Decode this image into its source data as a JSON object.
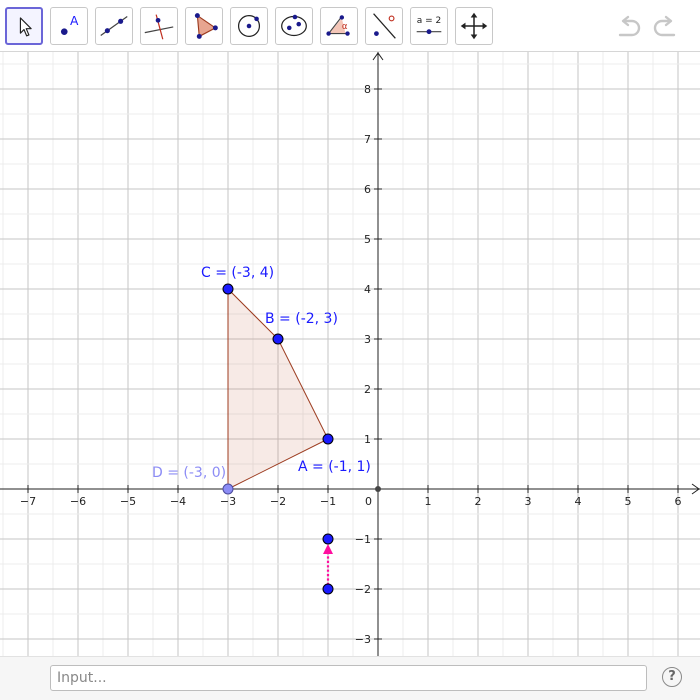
{
  "toolbar": {
    "tools": [
      {
        "icon": "move-arrow-icon",
        "active": true
      },
      {
        "icon": "point-icon",
        "label": "A"
      },
      {
        "icon": "line-through-two-points-icon"
      },
      {
        "icon": "perpendicular-line-icon"
      },
      {
        "icon": "polygon-icon"
      },
      {
        "icon": "circle-with-center-icon"
      },
      {
        "icon": "ellipse-icon"
      },
      {
        "icon": "angle-icon",
        "label": "α"
      },
      {
        "icon": "reflect-about-line-icon"
      },
      {
        "icon": "slider-icon",
        "label": "a = 2"
      },
      {
        "icon": "move-graphics-view-icon"
      }
    ],
    "undo_icon": "undo-icon",
    "redo_icon": "redo-icon"
  },
  "graph": {
    "x_ticks": [
      -7,
      -6,
      -5,
      -4,
      -3,
      -2,
      -1,
      1,
      2,
      3,
      4,
      5,
      6
    ],
    "y_ticks": [
      -3,
      -2,
      -1,
      1,
      2,
      3,
      4,
      5,
      6,
      7,
      8
    ],
    "origin_label": "0",
    "polygon": {
      "vertices": [
        "D",
        "A",
        "B",
        "C"
      ],
      "fill": "#c0522f",
      "stroke": "#9c3b1f"
    },
    "points": [
      {
        "name": "A",
        "x": -1,
        "y": 1,
        "label": "A = (-1, 1)",
        "color": "#1a1aff"
      },
      {
        "name": "B",
        "x": -2,
        "y": 3,
        "label": "B = (-2, 3)",
        "color": "#1a1aff"
      },
      {
        "name": "C",
        "x": -3,
        "y": 4,
        "label": "C = (-3, 4)",
        "color": "#1a1aff"
      },
      {
        "name": "D",
        "x": -3,
        "y": 0,
        "label": "D = (-3, 0)",
        "color": "#8c8cf5"
      }
    ],
    "vector": {
      "from": [
        -1,
        -2
      ],
      "to": [
        -1,
        -1
      ],
      "color": "#ff0f9f"
    }
  },
  "input_bar": {
    "placeholder": "Input...",
    "help_label": "?"
  }
}
